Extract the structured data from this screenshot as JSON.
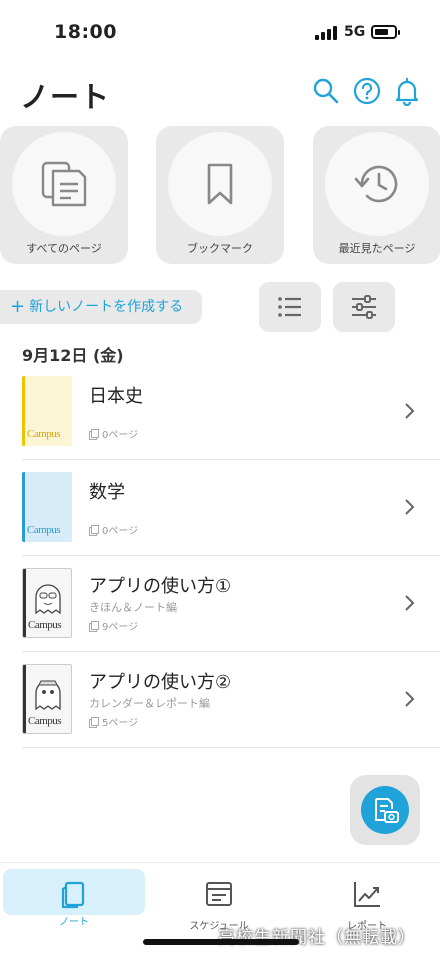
{
  "status": {
    "time": "18:00",
    "network": "5G"
  },
  "header": {
    "title": "ノート"
  },
  "shortcuts": [
    {
      "label": "すべてのページ",
      "icon": "document-stack-icon"
    },
    {
      "label": "ブックマーク",
      "icon": "bookmark-icon"
    },
    {
      "label": "最近見たページ",
      "icon": "history-icon"
    }
  ],
  "toolbar": {
    "new_note_label": "新しいノートを作成する"
  },
  "date_header": "9月12日 (金)",
  "notes": [
    {
      "title": "日本史",
      "subtitle": "",
      "pages": "0ページ",
      "cover_color": "#f2c200",
      "brand": "Campus"
    },
    {
      "title": "数学",
      "subtitle": "",
      "pages": "0ページ",
      "cover_color": "#2b9bd6",
      "brand": "Campus"
    },
    {
      "title": "アプリの使い方①",
      "subtitle": "きほん＆ノート編",
      "pages": "9ページ",
      "cover_color": "#333333",
      "brand": "Campus"
    },
    {
      "title": "アプリの使い方②",
      "subtitle": "カレンダー＆レポート編",
      "pages": "5ページ",
      "cover_color": "#333333",
      "brand": "Campus"
    }
  ],
  "tabs": [
    {
      "label": "ノート",
      "active": true
    },
    {
      "label": "スケジュール",
      "active": false
    },
    {
      "label": "レポート",
      "active": false
    }
  ],
  "watermark": "高校生新聞社（無転載）",
  "colors": {
    "accent": "#1fa3d9",
    "button_bg": "#e9e9ea"
  }
}
